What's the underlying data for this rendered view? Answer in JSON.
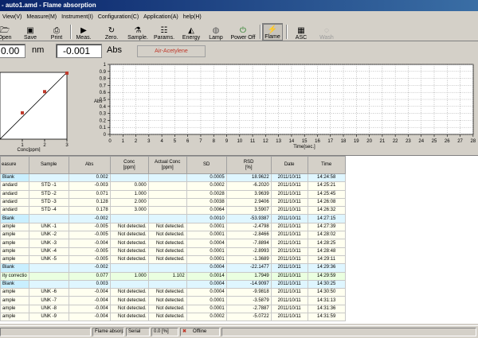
{
  "window": {
    "title": "- auto1.amd - Flame absorption"
  },
  "menu": [
    "View(V)",
    "Measure(M)",
    "Instrument(I)",
    "Configuration(C)",
    "Application(A)",
    "help(H)"
  ],
  "toolbar": {
    "buttons": [
      {
        "label": "Open",
        "icon": "folder-icon"
      },
      {
        "label": "Save",
        "icon": "floppy-disk-icon"
      },
      {
        "label": "Print",
        "icon": "printer-icon"
      },
      {
        "label": "Meas.",
        "icon": "play-icon"
      },
      {
        "label": "Zero.",
        "icon": "zero-icon"
      },
      {
        "label": "Sample.",
        "icon": "sample-icon"
      },
      {
        "label": "Params.",
        "icon": "params-icon"
      },
      {
        "label": "Energy",
        "icon": "energy-icon"
      },
      {
        "label": "Lamp",
        "icon": "lamp-icon"
      },
      {
        "label": "Power Off",
        "icon": "power-icon"
      },
      {
        "label": "Flame",
        "icon": "lightning-icon"
      },
      {
        "label": "ASC",
        "icon": "autosampler-icon"
      },
      {
        "label": "Wash",
        "icon": "wash-icon"
      }
    ]
  },
  "readout": {
    "wavelength": "0.00",
    "wavelength_unit": "nm",
    "absorbance": "-0.001",
    "absorbance_unit": "Abs",
    "gas": "Air-Acetylene"
  },
  "calibration_chart": {
    "x_label": "Conc[ppm]",
    "x_ticks": [
      "1",
      "2",
      "3"
    ],
    "points": [
      {
        "x": 1.0,
        "y": 0.071
      },
      {
        "x": 2.0,
        "y": 0.128
      },
      {
        "x": 3.0,
        "y": 0.178
      }
    ],
    "line": [
      {
        "x": 0,
        "y": 0.0
      },
      {
        "x": 3.0,
        "y": 0.18
      }
    ],
    "point_color": "#c0392b"
  },
  "scan_chart": {
    "y_label": "Abs",
    "y_ticks": [
      "0",
      "0.1",
      "0.2",
      "0.3",
      "0.4",
      "0.5",
      "0.6",
      "0.7",
      "0.8",
      "0.9",
      "1"
    ],
    "x_label": "Time[sec.]",
    "x_ticks": [
      "0",
      "1",
      "2",
      "3",
      "4",
      "5",
      "6",
      "7",
      "8",
      "9",
      "10",
      "11",
      "12",
      "13",
      "14",
      "15",
      "16",
      "17",
      "18",
      "19",
      "20",
      "21",
      "22",
      "23",
      "24",
      "25",
      "26",
      "27",
      "28"
    ]
  },
  "table": {
    "headers": [
      "easure",
      "Sample",
      "Abs",
      "Conc\n[ppm]",
      "Actual Conc\n[ppm]",
      "SD",
      "RSD\n[%]",
      "Date",
      "Time"
    ],
    "rows": [
      {
        "kind": "blank",
        "cells": [
          "Blank",
          "",
          "0.002",
          "",
          "",
          "0.0005",
          "18.9622",
          "2011/10/11",
          "14:24:58"
        ]
      },
      {
        "kind": "std",
        "cells": [
          "andard",
          "STD -1",
          "-0.003",
          "0.000",
          "",
          "0.0002",
          "-6.2020",
          "2011/10/11",
          "14:25:21"
        ]
      },
      {
        "kind": "std",
        "cells": [
          "andard",
          "STD -2",
          "0.071",
          "1.000",
          "",
          "0.0028",
          "3.9639",
          "2011/10/11",
          "14:25:45"
        ]
      },
      {
        "kind": "std",
        "cells": [
          "andard",
          "STD -3",
          "0.128",
          "2.000",
          "",
          "0.0038",
          "2.9406",
          "2011/10/11",
          "14:26:08"
        ]
      },
      {
        "kind": "std",
        "cells": [
          "andard",
          "STD -4",
          "0.178",
          "3.000",
          "",
          "0.0064",
          "3.5907",
          "2011/10/11",
          "14:26:32"
        ]
      },
      {
        "kind": "blank",
        "cells": [
          "Blank",
          "",
          "-0.002",
          "",
          "",
          "0.0010",
          "-53.9387",
          "2011/10/11",
          "14:27:15"
        ]
      },
      {
        "kind": "unk",
        "cells": [
          "ample",
          "UNK -1",
          "-0.005",
          "Not detected.",
          "Not detected.",
          "0.0001",
          "-2.4798",
          "2011/10/11",
          "14:27:39"
        ]
      },
      {
        "kind": "unk",
        "cells": [
          "ample",
          "UNK -2",
          "-0.005",
          "Not detected.",
          "Not detected.",
          "0.0001",
          "-2.8466",
          "2011/10/11",
          "14:28:02"
        ]
      },
      {
        "kind": "unk",
        "cells": [
          "ample",
          "UNK -3",
          "-0.004",
          "Not detected.",
          "Not detected.",
          "0.0004",
          "-7.8894",
          "2011/10/11",
          "14:28:25"
        ]
      },
      {
        "kind": "unk",
        "cells": [
          "ample",
          "UNK -4",
          "-0.005",
          "Not detected.",
          "Not detected.",
          "0.0001",
          "-2.8993",
          "2011/10/11",
          "14:28:48"
        ]
      },
      {
        "kind": "unk",
        "cells": [
          "ample",
          "UNK -5",
          "-0.005",
          "Not detected.",
          "Not detected.",
          "0.0001",
          "-1.3689",
          "2011/10/11",
          "14:29:11"
        ]
      },
      {
        "kind": "blank",
        "cells": [
          "Blank",
          "",
          "-0.002",
          "",
          "",
          "0.0004",
          "-22.1477",
          "2011/10/11",
          "14:29:36"
        ]
      },
      {
        "kind": "corr",
        "cells": [
          "ity correctio",
          "",
          "0.077",
          "1.000",
          "1.102",
          "0.0014",
          "1.7949",
          "2011/10/11",
          "14:29:59"
        ]
      },
      {
        "kind": "blank",
        "cells": [
          "Blank",
          "",
          "0.003",
          "",
          "",
          "0.0004",
          "-14.9097",
          "2011/10/11",
          "14:30:25"
        ]
      },
      {
        "kind": "unk",
        "cells": [
          "ample",
          "UNK -6",
          "-0.004",
          "Not detected.",
          "Not detected.",
          "0.0004",
          "-9.9818",
          "2011/10/11",
          "14:30:50"
        ]
      },
      {
        "kind": "unk",
        "cells": [
          "ample",
          "UNK -7",
          "-0.004",
          "Not detected.",
          "Not detected.",
          "0.0001",
          "-3.5879",
          "2011/10/11",
          "14:31:13"
        ]
      },
      {
        "kind": "unk",
        "cells": [
          "ample",
          "UNK -8",
          "-0.004",
          "Not detected.",
          "Not detected.",
          "0.0001",
          "-2.7887",
          "2011/10/11",
          "14:31:36"
        ]
      },
      {
        "kind": "unk",
        "cells": [
          "ample",
          "UNK -9",
          "-0.004",
          "Not detected.",
          "Not detected.",
          "0.0002",
          "-5.0722",
          "2011/10/11",
          "14:31:59"
        ]
      }
    ]
  },
  "statusbar": {
    "mode": "Flame absorptio",
    "port": "Serial",
    "progress": "0.0 [%]",
    "connection": "Offline"
  }
}
